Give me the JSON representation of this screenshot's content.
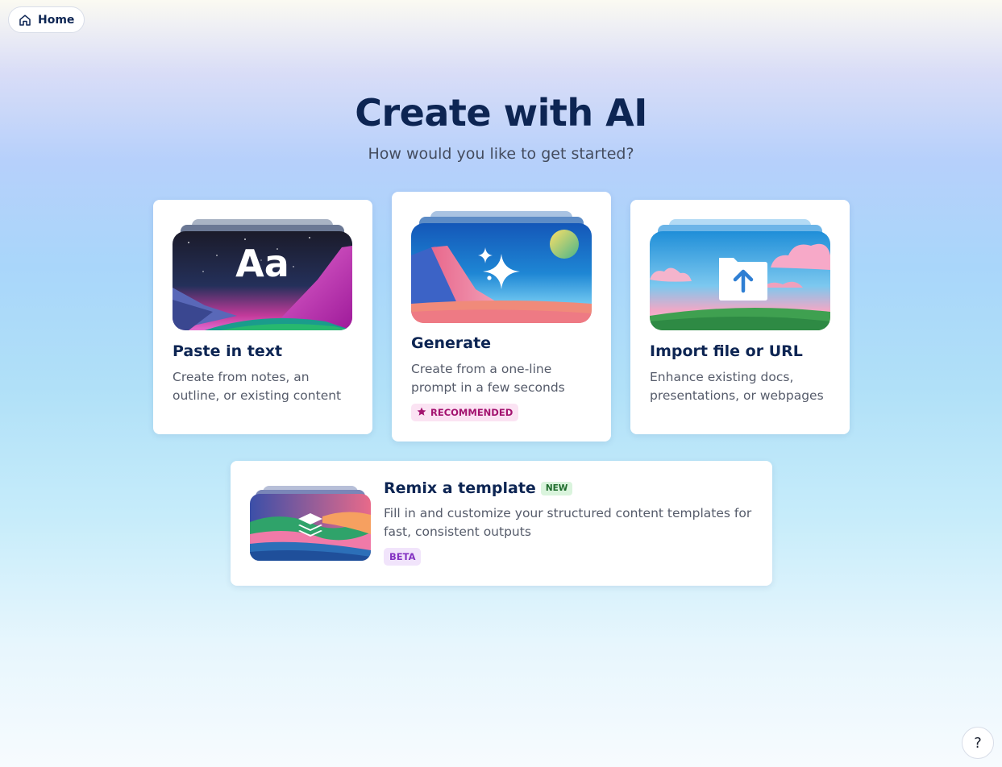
{
  "nav": {
    "home_label": "Home"
  },
  "header": {
    "title": "Create with AI",
    "subtitle": "How would you like to get started?"
  },
  "cards": [
    {
      "title": "Paste in text",
      "description": "Create from notes, an outline, or existing content",
      "thumb_text": "Aa"
    },
    {
      "title": "Generate",
      "description": "Create from a one-line prompt in a few seconds",
      "badge": "RECOMMENDED"
    },
    {
      "title": "Import file or URL",
      "description": "Enhance existing docs, presentations, or webpages"
    }
  ],
  "remix": {
    "title": "Remix a template",
    "new_badge": "NEW",
    "description": "Fill in and customize your structured content templates for fast, consistent outputs",
    "beta_badge": "BETA"
  },
  "help": {
    "label": "?"
  },
  "colors": {
    "heading": "#0d2553",
    "recommended_bg": "#fbe3f3",
    "recommended_text": "#a3136f",
    "new_bg": "#daf4dd",
    "beta_bg": "#f1e4fb"
  }
}
